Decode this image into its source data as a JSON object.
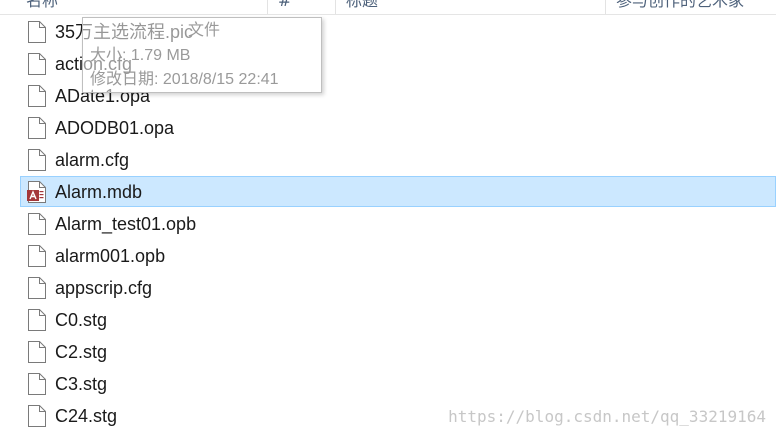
{
  "header": {
    "columns": [
      {
        "label": "名称"
      },
      {
        "label": "#"
      },
      {
        "label": "标题"
      },
      {
        "label": "参与创作的艺术家"
      }
    ]
  },
  "files": [
    {
      "name": "35万主选流程.pic",
      "icon": "file-icon",
      "selected": false
    },
    {
      "name": "action.cfg",
      "icon": "file-icon",
      "selected": false
    },
    {
      "name": "ADate1.opa",
      "icon": "file-icon",
      "selected": false
    },
    {
      "name": "ADODB01.opa",
      "icon": "file-icon",
      "selected": false
    },
    {
      "name": "alarm.cfg",
      "icon": "file-icon",
      "selected": false
    },
    {
      "name": "Alarm.mdb",
      "icon": "access-database-icon",
      "selected": true
    },
    {
      "name": "Alarm_test01.opb",
      "icon": "file-icon",
      "selected": false
    },
    {
      "name": "alarm001.opb",
      "icon": "file-icon",
      "selected": false
    },
    {
      "name": "appscrip.cfg",
      "icon": "file-icon",
      "selected": false
    },
    {
      "name": "C0.stg",
      "icon": "file-icon",
      "selected": false
    },
    {
      "name": "C2.stg",
      "icon": "file-icon",
      "selected": false
    },
    {
      "name": "C3.stg",
      "icon": "file-icon",
      "selected": false
    },
    {
      "name": "C24.stg",
      "icon": "file-icon",
      "selected": false
    }
  ],
  "tooltip": {
    "type_line": "文件",
    "size_line": "大小: 1.79 MB",
    "modified_line": "修改日期: 2018/8/15 22:41"
  },
  "watermark": "https://blog.csdn.net/qq_33219164",
  "colors": {
    "selection_bg": "#cce8ff",
    "selection_border": "#99d1ff",
    "access_red": "#a4373a"
  }
}
